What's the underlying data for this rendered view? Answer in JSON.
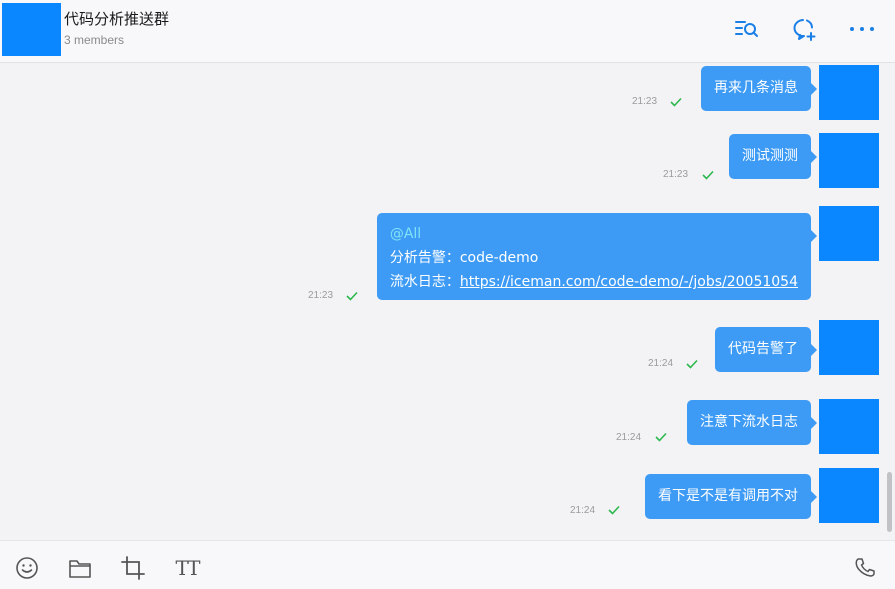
{
  "header": {
    "title": "代码分析推送群",
    "members": "3 members",
    "icons": [
      "search-history-icon",
      "chat-add-icon",
      "more-icon"
    ]
  },
  "messages": [
    {
      "text": "再来几条消息",
      "time": "21:23",
      "status": "sent"
    },
    {
      "text": "测试测测",
      "time": "21:23",
      "status": "sent"
    },
    {
      "mention": "@All",
      "line2": "分析告警：code-demo",
      "line3_label": "流水日志：",
      "link": "https://iceman.com/code-demo/-/jobs/20051054",
      "time": "21:23",
      "status": "sent"
    },
    {
      "text": "代码告警了",
      "time": "21:24",
      "status": "sent"
    },
    {
      "text": "注意下流水日志",
      "time": "21:24",
      "status": "sent"
    },
    {
      "text": "看下是不是有调用不对",
      "time": "21:24",
      "status": "sent"
    }
  ],
  "toolbar": {
    "icons": [
      "emoji-icon",
      "folder-icon",
      "crop-icon",
      "text-format-icon",
      "phone-icon"
    ],
    "text_format_glyph": "TT"
  },
  "colors": {
    "bubble": "#3d9bf5",
    "avatar": "#0a86ff",
    "check": "#2db84d",
    "header_icon": "#1a7fe6"
  }
}
